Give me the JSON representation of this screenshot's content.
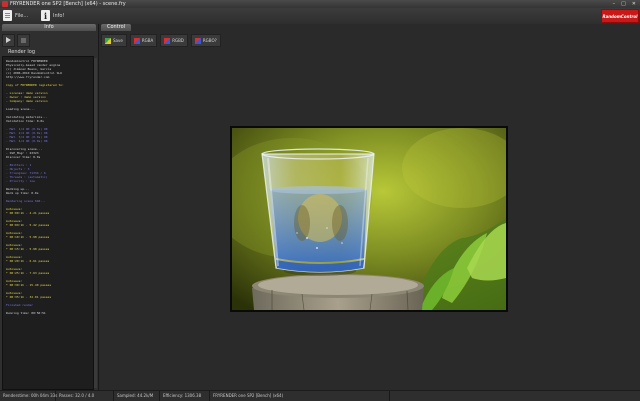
{
  "window": {
    "title": "FRYRENDER one SP2 [Bench] (x64) - scene.fry",
    "minimize": "–",
    "maximize": "□",
    "close": "✕"
  },
  "toolbar": {
    "file_label": "File...",
    "info_label": "Info!",
    "info_glyph": "i"
  },
  "logo": {
    "text": "RandomControl",
    "color": "#c81818"
  },
  "left_panel": {
    "tab_label": "Info",
    "render_log_label": "Render log",
    "log_lines": [
      {
        "text": "RandomControl FRYRENDER",
        "color": "white"
      },
      {
        "text": "Physically-based render engine",
        "color": "white"
      },
      {
        "text": "(c) Jiménez Bueno, García",
        "color": "white"
      },
      {
        "text": "(c) 2006-2010 RandomControl SLU",
        "color": "white"
      },
      {
        "text": "http://www.fryrender.com",
        "color": "white"
      },
      {
        "text": "",
        "color": "white"
      },
      {
        "text": "Copy of FRYRENDER registered to:",
        "color": "yellow"
      },
      {
        "text": "",
        "color": "white"
      },
      {
        "text": "- License: demo version",
        "color": "yellow"
      },
      {
        "text": "- Owner  : demo version",
        "color": "yellow"
      },
      {
        "text": "- Company: demo version",
        "color": "yellow"
      },
      {
        "text": "",
        "color": "white"
      },
      {
        "text": "Loading scene...",
        "color": "white"
      },
      {
        "text": "",
        "color": "white"
      },
      {
        "text": "Validating materials...",
        "color": "white"
      },
      {
        "text": "Validation time: 0.0s",
        "color": "white"
      },
      {
        "text": "",
        "color": "white"
      },
      {
        "text": "- Mat. 1/4 OK (0.0s) OK",
        "color": "blue"
      },
      {
        "text": "- Mat. 2/4 OK (0.0s) OK",
        "color": "blue"
      },
      {
        "text": "- Mat. 3/4 OK (0.0s) OK",
        "color": "blue"
      },
      {
        "text": "- Mat. 4/4 OK (0.0s) OK",
        "color": "blue"
      },
      {
        "text": "",
        "color": "white"
      },
      {
        "text": "Discovering scene...",
        "color": "white"
      },
      {
        "text": "- SSE_Mngr    : 23323",
        "color": "white"
      },
      {
        "text": "Discover time: 0.0s",
        "color": "white"
      },
      {
        "text": "",
        "color": "white"
      },
      {
        "text": "- Emitters  : 1",
        "color": "blue"
      },
      {
        "text": "- Objects   : 3",
        "color": "blue"
      },
      {
        "text": "- Triangles: 71334 / 6",
        "color": "blue"
      },
      {
        "text": "- Threads  : (automatic)",
        "color": "blue"
      },
      {
        "text": "- Priority : low",
        "color": "blue"
      },
      {
        "text": "",
        "color": "white"
      },
      {
        "text": "Warming up...",
        "color": "white"
      },
      {
        "text": "Warm up time: 0.0s",
        "color": "white"
      },
      {
        "text": "",
        "color": "white"
      },
      {
        "text": "Rendering scene 640...",
        "color": "blue"
      },
      {
        "text": "",
        "color": "white"
      },
      {
        "text": "Autosave:",
        "color": "yellow"
      },
      {
        "text": "* 00:00:1h - 4.21 passes",
        "color": "yellow"
      },
      {
        "text": "",
        "color": "white"
      },
      {
        "text": "Autosave:",
        "color": "yellow"
      },
      {
        "text": "* 00:09:1h - 5.42 passes",
        "color": "yellow"
      },
      {
        "text": "",
        "color": "white"
      },
      {
        "text": "Autosave:",
        "color": "yellow"
      },
      {
        "text": "* 00:10:1h - 5.98 passes",
        "color": "yellow"
      },
      {
        "text": "",
        "color": "white"
      },
      {
        "text": "Autosave:",
        "color": "yellow"
      },
      {
        "text": "* 00:15:1h - 5.98 passes",
        "color": "yellow"
      },
      {
        "text": "",
        "color": "white"
      },
      {
        "text": "Autosave:",
        "color": "yellow"
      },
      {
        "text": "* 00:20:1h - 6.61 passes",
        "color": "yellow"
      },
      {
        "text": "",
        "color": "white"
      },
      {
        "text": "Autosave:",
        "color": "yellow"
      },
      {
        "text": "* 00:25:1h - 7.63 passes",
        "color": "yellow"
      },
      {
        "text": "",
        "color": "white"
      },
      {
        "text": "Autosave:",
        "color": "yellow"
      },
      {
        "text": "* 00:30:1h - 15.40 passes",
        "color": "yellow"
      },
      {
        "text": "",
        "color": "white"
      },
      {
        "text": "Autosave:",
        "color": "yellow"
      },
      {
        "text": "* 00:35:1h - 32.01 passes",
        "color": "yellow"
      },
      {
        "text": "",
        "color": "white"
      },
      {
        "text": "Finished render",
        "color": "blue"
      },
      {
        "text": "",
        "color": "white"
      },
      {
        "text": "Running time: 00:50:51",
        "color": "white"
      }
    ]
  },
  "main": {
    "tab_label": "Control",
    "buttons": [
      {
        "label": "Save",
        "icon": "save-icon"
      },
      {
        "label": "RGBA",
        "icon": "rgba-icon"
      },
      {
        "label": "RGBD",
        "icon": "rgbd-icon"
      },
      {
        "label": "RGBO?",
        "icon": "rgbo-icon"
      }
    ]
  },
  "statusbar": {
    "cells": [
      "Renderstime: 00h 04m 33s",
      "Passes: 32.0 / 4.0",
      "Sampled: 44.2k/M",
      "Efficiency: 1306.38",
      "FRYRENDER one SP2 [Bench] (x64)"
    ]
  }
}
